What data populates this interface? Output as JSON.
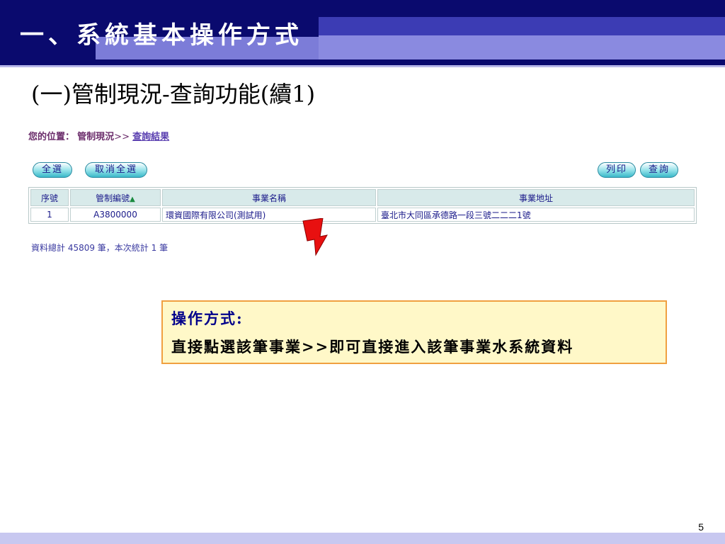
{
  "slide": {
    "title": "一、系統基本操作方式",
    "subtitle": "(一)管制現況-查詢功能(續1)",
    "page_number": "5"
  },
  "breadcrumb": {
    "prefix": "您的位置：",
    "section": "管制現況",
    "separator": ">>",
    "current": "查詢結果"
  },
  "buttons": {
    "select_all": "全選",
    "deselect_all": "取消全選",
    "print": "列印",
    "query": "查詢"
  },
  "table": {
    "headers": [
      "序號",
      "管制編號",
      "事業名稱",
      "事業地址"
    ],
    "sort_indicator": "▲",
    "rows": [
      [
        "1",
        "A3800000",
        "環資國際有限公司(測試用)",
        "臺北市大同區承德路一段三號二二二1號"
      ]
    ]
  },
  "summary": "資料總計 45809 筆，本次統計 1 筆",
  "note": {
    "heading": "操作方式:",
    "body": "直接點選該筆事業>>即可直接進入該筆事業水系統資料"
  },
  "colors": {
    "header_dark": "#0a0a6e",
    "header_stripe": "#7c7cd8",
    "arrow": "#e81010",
    "note_bg": "#fff8c8",
    "note_border": "#f0a040"
  }
}
